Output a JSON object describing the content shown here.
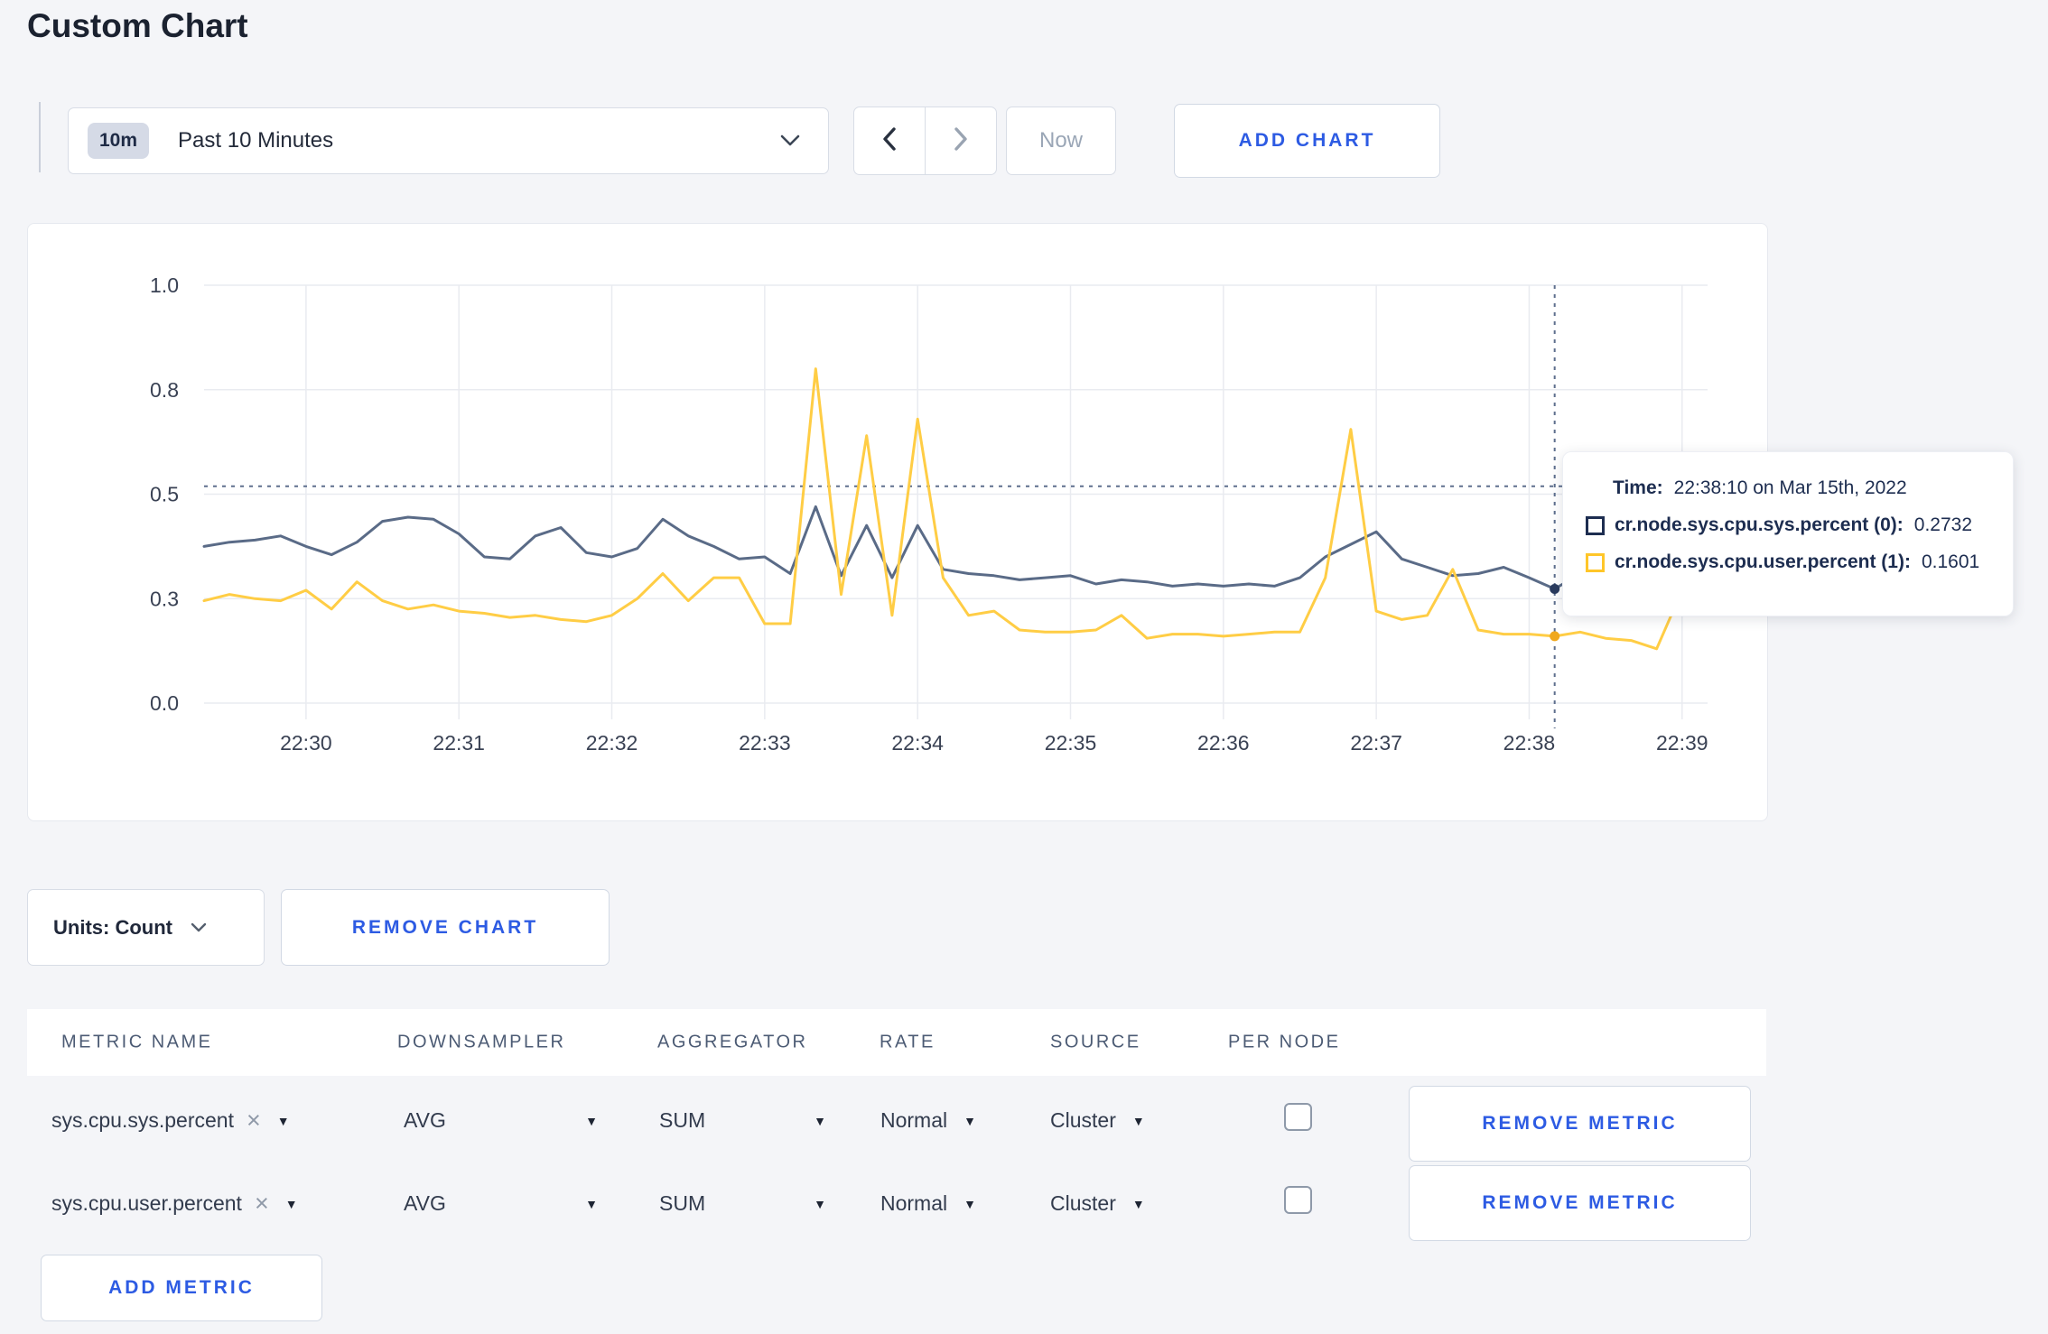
{
  "page": {
    "title": "Custom Chart"
  },
  "icons": {
    "dropdown_arrow": "▼",
    "clear": "×"
  },
  "colors": {
    "accent_blue": "#2d5be3",
    "page_bg": "#f4f5f8",
    "sys_line": "#5a6b87",
    "user_line": "#ffcd45",
    "sys_swatch": "#1d2d50",
    "user_swatch": "#ffc629"
  },
  "toolbar": {
    "time_range_badge": "10m",
    "time_range_label": "Past 10 Minutes",
    "now_label": "Now",
    "add_chart_label": "ADD CHART"
  },
  "chart_tooltip": {
    "time_label": "Time:",
    "time_value": "22:38:10 on Mar 15th, 2022",
    "series": [
      {
        "name": "cr.node.sys.cpu.sys.percent (0):",
        "value": "0.2732"
      },
      {
        "name": "cr.node.sys.cpu.user.percent (1):",
        "value": "0.1601"
      }
    ]
  },
  "chart_data": {
    "type": "line",
    "title": "",
    "xlabel": "",
    "ylabel": "",
    "ylim": [
      0,
      1
    ],
    "grid": true,
    "grid_color": "#e9ebf0",
    "axis_label_color": "#3a4254",
    "crosshair_color": "#5e6f8d",
    "start_time": "22:29:20",
    "interval_seconds": 10,
    "x_ticks": [
      {
        "index": 4,
        "label": "22:30"
      },
      {
        "index": 10,
        "label": "22:31"
      },
      {
        "index": 16,
        "label": "22:32"
      },
      {
        "index": 22,
        "label": "22:33"
      },
      {
        "index": 28,
        "label": "22:34"
      },
      {
        "index": 34,
        "label": "22:35"
      },
      {
        "index": 40,
        "label": "22:36"
      },
      {
        "index": 46,
        "label": "22:37"
      },
      {
        "index": 52,
        "label": "22:38"
      },
      {
        "index": 58,
        "label": "22:39"
      }
    ],
    "y_ticks": [
      {
        "value": 0,
        "label": "0.0"
      },
      {
        "value": 0.25,
        "label": "0.3"
      },
      {
        "value": 0.5,
        "label": "0.5"
      },
      {
        "value": 0.75,
        "label": "0.8"
      },
      {
        "value": 1.0,
        "label": "1.0"
      }
    ],
    "crosshair": {
      "index": 53,
      "time": "22:38:10",
      "y_value": 0.519
    },
    "series": [
      {
        "name": "cr.node.sys.cpu.sys.percent",
        "color": "#5a6b87",
        "dot_color": "#2a3b5e",
        "values": [
          0.375,
          0.385,
          0.39,
          0.4,
          0.375,
          0.355,
          0.385,
          0.435,
          0.445,
          0.44,
          0.405,
          0.35,
          0.345,
          0.4,
          0.42,
          0.36,
          0.35,
          0.37,
          0.44,
          0.4,
          0.375,
          0.345,
          0.35,
          0.31,
          0.47,
          0.305,
          0.425,
          0.3,
          0.425,
          0.32,
          0.31,
          0.305,
          0.295,
          0.3,
          0.305,
          0.285,
          0.295,
          0.29,
          0.28,
          0.285,
          0.28,
          0.285,
          0.28,
          0.3,
          0.35,
          0.38,
          0.41,
          0.345,
          0.325,
          0.305,
          0.31,
          0.325,
          0.3,
          0.2732,
          0.31,
          0.295,
          0.3,
          0.31,
          0.3,
          0.305
        ]
      },
      {
        "name": "cr.node.sys.cpu.user.percent",
        "color": "#ffcd45",
        "dot_color": "#f0a81e",
        "values": [
          0.245,
          0.26,
          0.25,
          0.245,
          0.27,
          0.225,
          0.29,
          0.245,
          0.225,
          0.235,
          0.22,
          0.215,
          0.205,
          0.21,
          0.2,
          0.195,
          0.21,
          0.25,
          0.31,
          0.245,
          0.3,
          0.3,
          0.19,
          0.19,
          0.8,
          0.26,
          0.64,
          0.21,
          0.68,
          0.3,
          0.21,
          0.22,
          0.175,
          0.17,
          0.17,
          0.175,
          0.21,
          0.155,
          0.165,
          0.165,
          0.16,
          0.165,
          0.17,
          0.17,
          0.3,
          0.655,
          0.22,
          0.2,
          0.21,
          0.32,
          0.175,
          0.165,
          0.165,
          0.1601,
          0.17,
          0.155,
          0.15,
          0.13,
          0.27,
          0.25
        ]
      }
    ]
  },
  "chart_footer": {
    "units_label": "Units: Count",
    "remove_chart_label": "REMOVE CHART"
  },
  "metrics_table": {
    "headers": {
      "metric_name": "METRIC NAME",
      "downsampler": "DOWNSAMPLER",
      "aggregator": "AGGREGATOR",
      "rate": "RATE",
      "source": "SOURCE",
      "per_node": "PER NODE"
    },
    "rows": [
      {
        "metric": "sys.cpu.sys.percent",
        "downsampler": "AVG",
        "aggregator": "SUM",
        "rate": "Normal",
        "source": "Cluster",
        "per_node_checked": false,
        "remove_label": "REMOVE METRIC"
      },
      {
        "metric": "sys.cpu.user.percent",
        "downsampler": "AVG",
        "aggregator": "SUM",
        "rate": "Normal",
        "source": "Cluster",
        "per_node_checked": false,
        "remove_label": "REMOVE METRIC"
      }
    ],
    "add_metric_label": "ADD METRIC"
  }
}
